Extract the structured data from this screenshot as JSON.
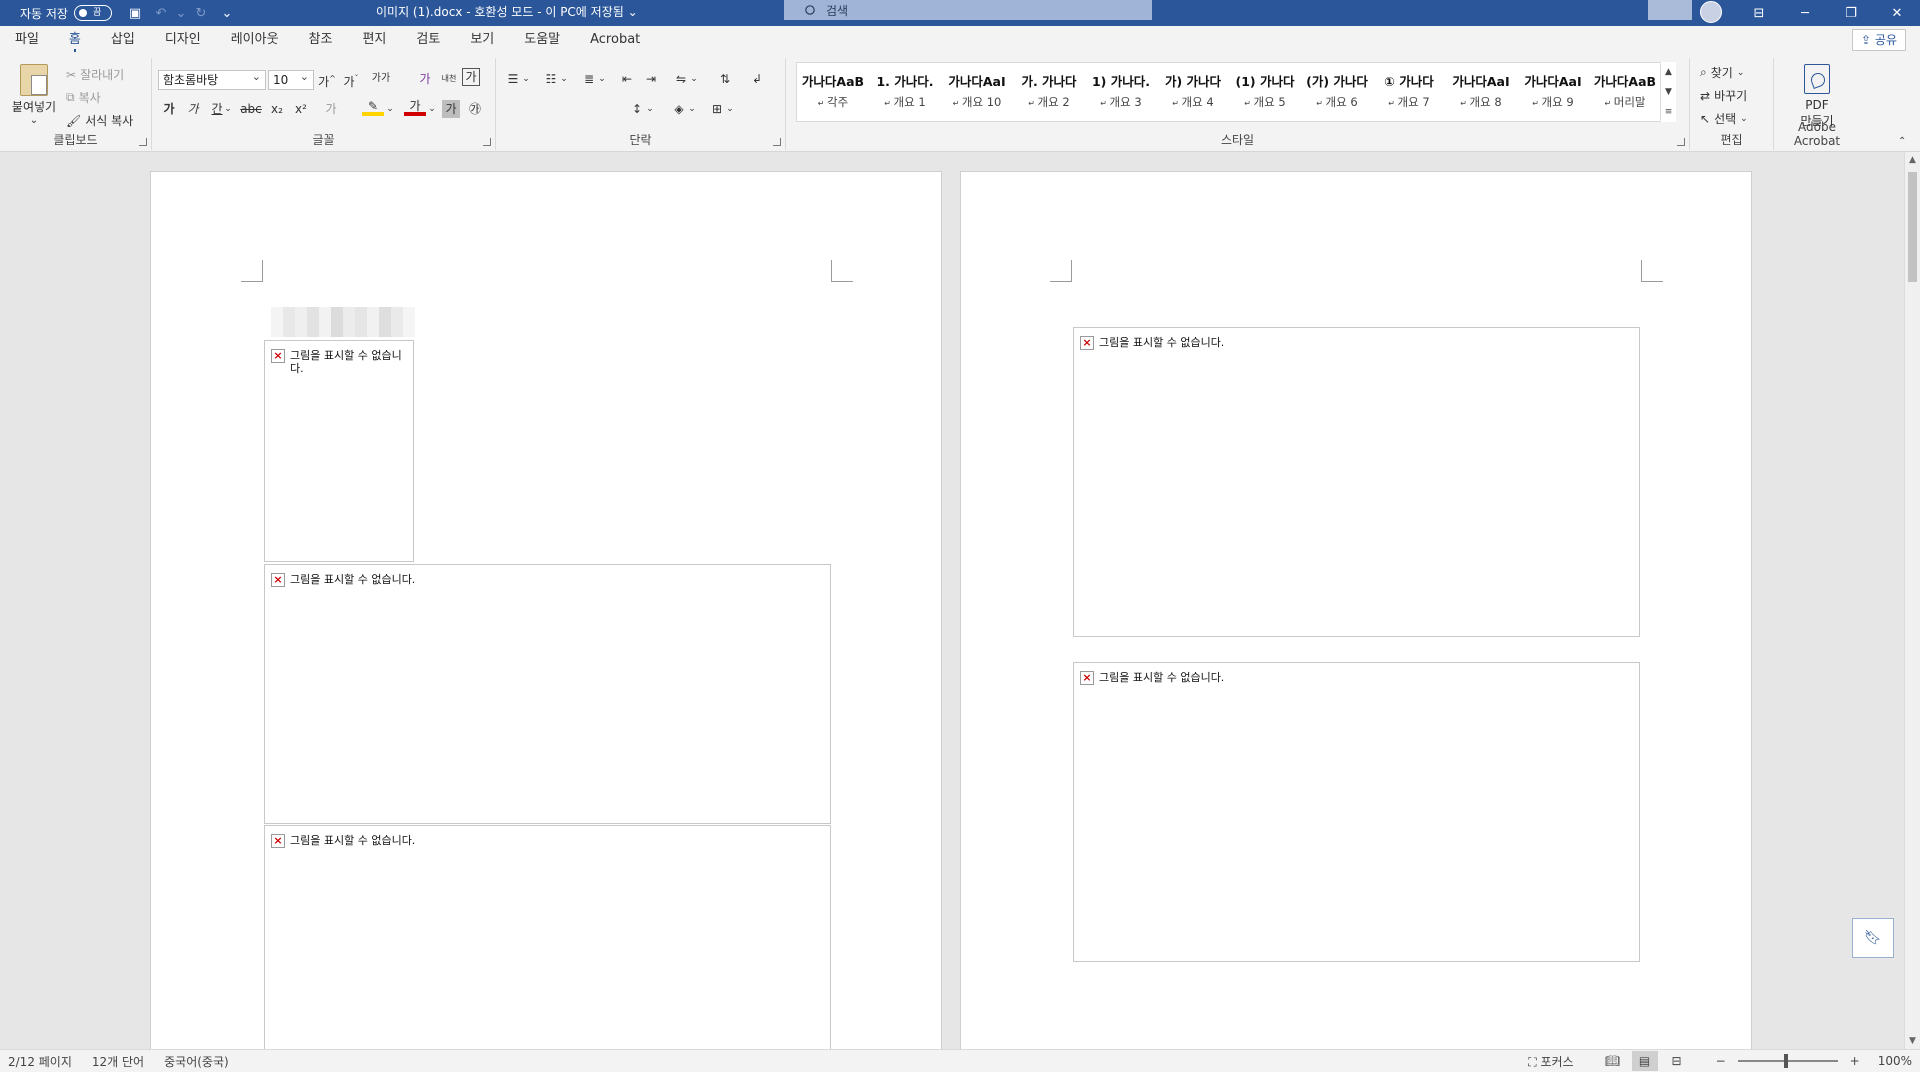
{
  "titlebar": {
    "autosave_label": "자동 저장",
    "autosave_state": "끔",
    "doc_title": "이미지 (1).docx  -  호환성 모드 - 이 PC에 저장됨",
    "search_placeholder": "검색"
  },
  "menu": {
    "tabs": [
      "파일",
      "홈",
      "삽입",
      "디자인",
      "레이아웃",
      "참조",
      "편지",
      "검토",
      "보기",
      "도움말",
      "Acrobat"
    ],
    "active_tab": "홈",
    "share_label": "공유"
  },
  "ribbon": {
    "clipboard": {
      "label": "클립보드",
      "paste": "붙여넣기",
      "cut": "잘라내기",
      "copy": "복사",
      "format_painter": "서식 복사"
    },
    "font": {
      "label": "글꼴",
      "font_name": "함초롬바탕",
      "font_size": "10",
      "bold": "가",
      "italic": "가",
      "underline": "간",
      "strike": "ᆉ",
      "sub": "x₂",
      "sup": "x²",
      "grow": "가",
      "shrink": "가",
      "case": "가가",
      "effects": "가",
      "color": "가",
      "shade": "가",
      "circle": "㉮",
      "hanja": "漢字",
      "phonetic": "내천",
      "char_border": "가"
    },
    "paragraph": {
      "label": "단락"
    },
    "styles": {
      "label": "스타일",
      "items": [
        {
          "sample": "가나다AaB",
          "name": "각주"
        },
        {
          "sample": "1.  가나다.",
          "name": "개요 1"
        },
        {
          "sample": "가나다AaI",
          "name": "개요 10"
        },
        {
          "sample": "가.  가나다",
          "name": "개요 2"
        },
        {
          "sample": "1)  가나다.",
          "name": "개요 3"
        },
        {
          "sample": "가)  가나다",
          "name": "개요 4"
        },
        {
          "sample": "(1)  가나다",
          "name": "개요 5"
        },
        {
          "sample": "(가)  가나다",
          "name": "개요 6"
        },
        {
          "sample": "①  가나다",
          "name": "개요 7"
        },
        {
          "sample": "가나다AaI",
          "name": "개요 8"
        },
        {
          "sample": "가나다AaI",
          "name": "개요 9"
        },
        {
          "sample": "가나다AaB",
          "name": "머리말"
        }
      ]
    },
    "editing": {
      "label": "편집",
      "find": "찾기",
      "replace": "바꾸기",
      "select": "선택"
    },
    "acrobat": {
      "label": "Adobe Acrobat",
      "create_pdf_line1": "PDF",
      "create_pdf_line2": "만들기"
    }
  },
  "document": {
    "broken_image_text": "그림을 표시할 수 없습니다.",
    "broken_image_text_narrow_1": "그림을 표시할 수 없습니",
    "broken_image_text_narrow_2": "다."
  },
  "statusbar": {
    "page": "2/12 페이지",
    "words": "12개 단어",
    "language": "중국어(중국)",
    "focus": "포커스",
    "zoom": "100%"
  },
  "colors": {
    "brand": "#2b579a",
    "broken_x": "#d00000"
  }
}
